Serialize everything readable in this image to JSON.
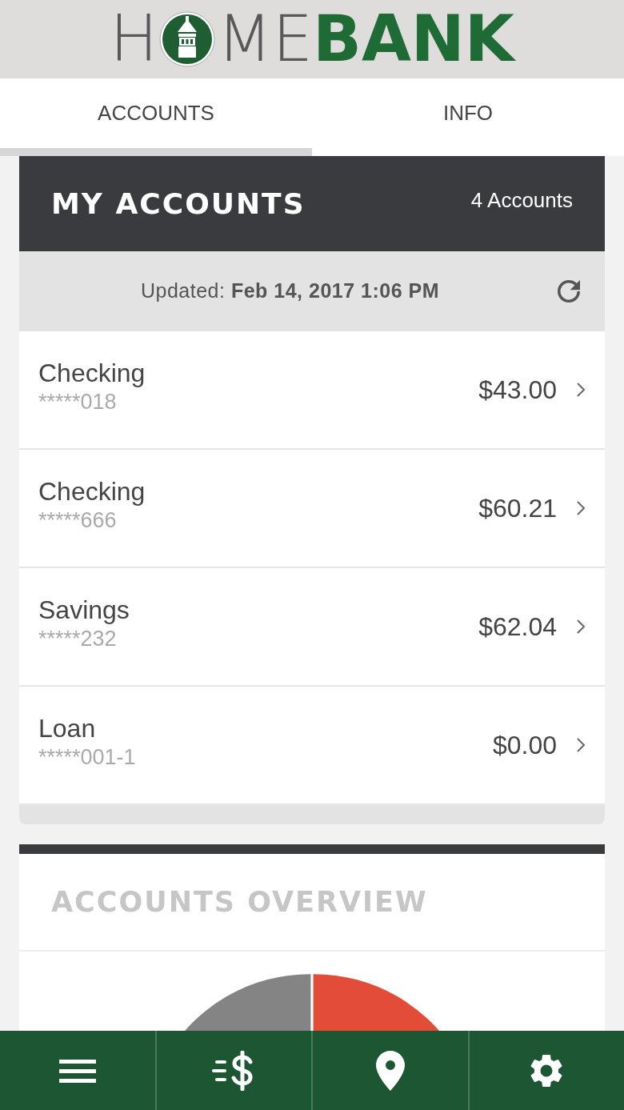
{
  "logo": {
    "start": "H",
    "middle": "ME",
    "end": "BANK"
  },
  "tabs": [
    {
      "label": "ACCOUNTS",
      "selected": true
    },
    {
      "label": "INFO",
      "selected": false
    }
  ],
  "accounts_card": {
    "title": "MY ACCOUNTS",
    "count": "4 Accounts",
    "updated": "Updated: **Feb 14, 2017 1:06 PM**",
    "accounts": [
      {
        "name": "Checking",
        "number": "*****018",
        "balance": "$43.00"
      },
      {
        "name": "Checking",
        "number": "*****666",
        "balance": "$60.21"
      },
      {
        "name": "Savings",
        "number": "*****232",
        "balance": "$62.04"
      },
      {
        "name": "Loan",
        "number": "*****001-1",
        "balance": "$0.00"
      }
    ]
  },
  "overview": {
    "title": "ACCOUNTS OVERVIEW"
  },
  "bottom_nav": [
    {
      "kind": "menu"
    },
    {
      "kind": "transfer"
    },
    {
      "kind": "location"
    },
    {
      "kind": "settings"
    }
  ]
}
